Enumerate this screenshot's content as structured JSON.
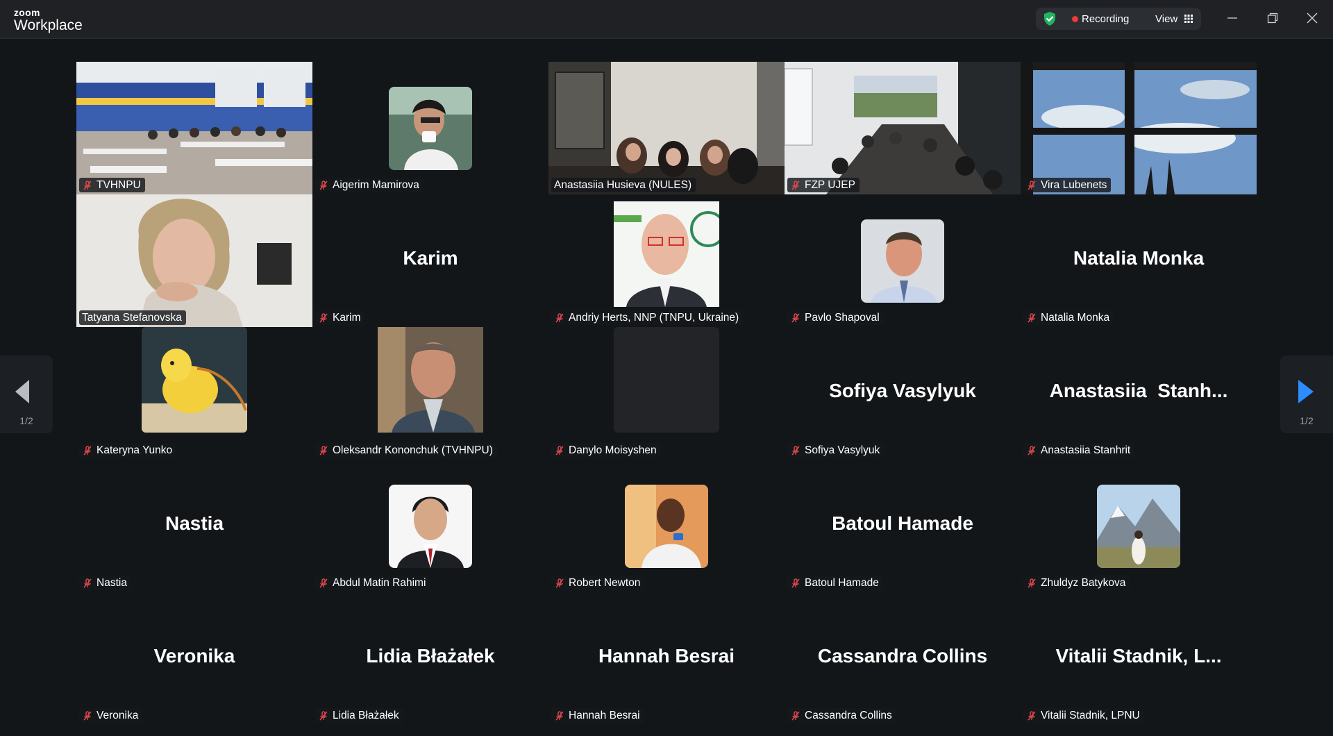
{
  "app": {
    "brand_top": "zoom",
    "brand_bottom": "Workplace"
  },
  "header": {
    "recording_label": "Recording",
    "view_label": "View",
    "icons": [
      "shield-check-icon",
      "recording-dot-icon",
      "grid-icon",
      "minimize-icon",
      "restore-icon",
      "close-icon"
    ]
  },
  "navigation": {
    "prev_page": "1/2",
    "next_page": "1/2"
  },
  "colors": {
    "active_speaker": "#2bd97b",
    "muted": "#e5484d",
    "background": "#131619",
    "accent": "#2d8cff"
  },
  "participants": [
    {
      "name": "TVHNPU",
      "media": "video",
      "muted": true
    },
    {
      "name": "Aigerim Mamirova",
      "media": "avatar",
      "muted": true
    },
    {
      "name": "Anastasiia Husieva (NULES)",
      "media": "video",
      "muted": false,
      "active_speaker": true
    },
    {
      "name": "FZP UJEP",
      "media": "video",
      "muted": true
    },
    {
      "name": "Vira Lubenets",
      "media": "video",
      "muted": true
    },
    {
      "name": "Tatyana Stefanovska",
      "media": "video",
      "muted": false
    },
    {
      "name": "Karim",
      "display_name": "Karim",
      "media": "name",
      "muted": true
    },
    {
      "name": "Andriy Herts, NNP (TNPU, Ukraine)",
      "media": "avatar",
      "muted": true
    },
    {
      "name": "Pavlo Shapoval",
      "media": "avatar",
      "muted": true
    },
    {
      "name": "Natalia Monka",
      "display_name": "Natalia Monka",
      "media": "name",
      "muted": true
    },
    {
      "name": "Kateryna Yunko",
      "media": "avatar",
      "muted": true
    },
    {
      "name": "Oleksandr Kononchuk (TVHNPU)",
      "media": "avatar",
      "muted": true
    },
    {
      "name": "Danylo Moisyshen",
      "media": "avatar",
      "muted": true
    },
    {
      "name": "Sofiya Vasylyuk",
      "display_name": "Sofiya Vasylyuk",
      "media": "name",
      "muted": true
    },
    {
      "name": "Anastasiia Stanhrit",
      "display_name": "Anastasiia  Stanh...",
      "media": "name",
      "muted": true
    },
    {
      "name": "Nastia",
      "display_name": "Nastia",
      "media": "name",
      "muted": true
    },
    {
      "name": "Abdul Matin Rahimi",
      "media": "avatar",
      "muted": true
    },
    {
      "name": "Robert Newton",
      "media": "avatar",
      "muted": true
    },
    {
      "name": "Batoul Hamade",
      "display_name": "Batoul Hamade",
      "media": "name",
      "muted": true
    },
    {
      "name": "Zhuldyz Batykova",
      "media": "avatar",
      "muted": true
    },
    {
      "name": "Veronika",
      "display_name": "Veronika",
      "media": "name",
      "muted": true
    },
    {
      "name": "Lidia Błażałek",
      "display_name": "Lidia Błażałek",
      "media": "name",
      "muted": true
    },
    {
      "name": "Hannah Besrai",
      "display_name": "Hannah Besrai",
      "media": "name",
      "muted": true
    },
    {
      "name": "Cassandra Collins",
      "display_name": "Cassandra Collins",
      "media": "name",
      "muted": true
    },
    {
      "name": "Vitalii Stadnik, LPNU",
      "display_name": "Vitalii Stadnik, L...",
      "media": "name",
      "muted": true
    }
  ]
}
